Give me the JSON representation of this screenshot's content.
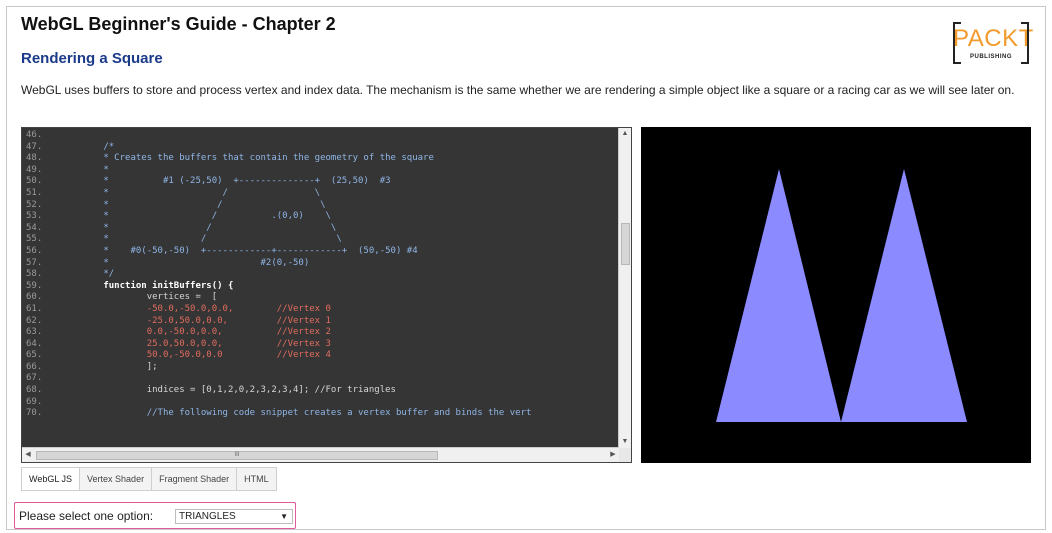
{
  "page": {
    "title": "WebGL Beginner's Guide - Chapter 2",
    "subtitle": "Rendering a Square",
    "description": "WebGL uses buffers to store and process vertex and index data. The mechanism is the same whether we are rendering a simple object like a square or a racing car as we will see later on."
  },
  "logo": {
    "word": "PACKT",
    "sub": "PUBLISHING"
  },
  "code_lines": [
    {
      "n": "46.",
      "t": ""
    },
    {
      "n": "47.",
      "t": "        /*"
    },
    {
      "n": "48.",
      "t": "        * Creates the buffers that contain the geometry of the square"
    },
    {
      "n": "49.",
      "t": "        *"
    },
    {
      "n": "50.",
      "t": "        *          #1 (-25,50)  +--------------+  (25,50)  #3"
    },
    {
      "n": "51.",
      "t": "        *                     /                \\"
    },
    {
      "n": "52.",
      "t": "        *                    /                  \\"
    },
    {
      "n": "53.",
      "t": "        *                   /          .(0,0)    \\"
    },
    {
      "n": "54.",
      "t": "        *                  /                      \\"
    },
    {
      "n": "55.",
      "t": "        *                 /                        \\"
    },
    {
      "n": "56.",
      "t": "        *    #0(-50,-50)  +------------+------------+  (50,-50) #4"
    },
    {
      "n": "57.",
      "t": "        *                            #2(0,-50)"
    },
    {
      "n": "58.",
      "t": "        */"
    },
    {
      "n": "59.",
      "t": "        function initBuffers() {"
    },
    {
      "n": "60.",
      "t": "                vertices =  ["
    },
    {
      "n": "61.",
      "t": "                -50.0,-50.0,0.0,        //Vertex 0"
    },
    {
      "n": "62.",
      "t": "                -25.0,50.0,0.0,         //Vertex 1"
    },
    {
      "n": "63.",
      "t": "                0.0,-50.0,0.0,          //Vertex 2"
    },
    {
      "n": "64.",
      "t": "                25.0,50.0,0.0,          //Vertex 3"
    },
    {
      "n": "65.",
      "t": "                50.0,-50.0,0.0          //Vertex 4"
    },
    {
      "n": "66.",
      "t": "                ];"
    },
    {
      "n": "67.",
      "t": ""
    },
    {
      "n": "68.",
      "t": "                indices = [0,1,2,0,2,3,2,3,4]; //For triangles"
    },
    {
      "n": "69.",
      "t": ""
    },
    {
      "n": "70.",
      "t": "                //The following code snippet creates a vertex buffer and binds the vert"
    }
  ],
  "scrollbar": {
    "hthumb_label": "III"
  },
  "tabs": [
    "WebGL JS",
    "Vertex Shader",
    "Fragment Shader",
    "HTML"
  ],
  "select": {
    "label": "Please select one option:",
    "value": "TRIANGLES"
  },
  "canvas": {
    "background": "#000000",
    "shape_color": "#8b8bff"
  },
  "colors": {
    "subtitle": "#1b3a8a",
    "logo_accent": "#f29b2d",
    "highlight_border": "#e05a9c"
  }
}
